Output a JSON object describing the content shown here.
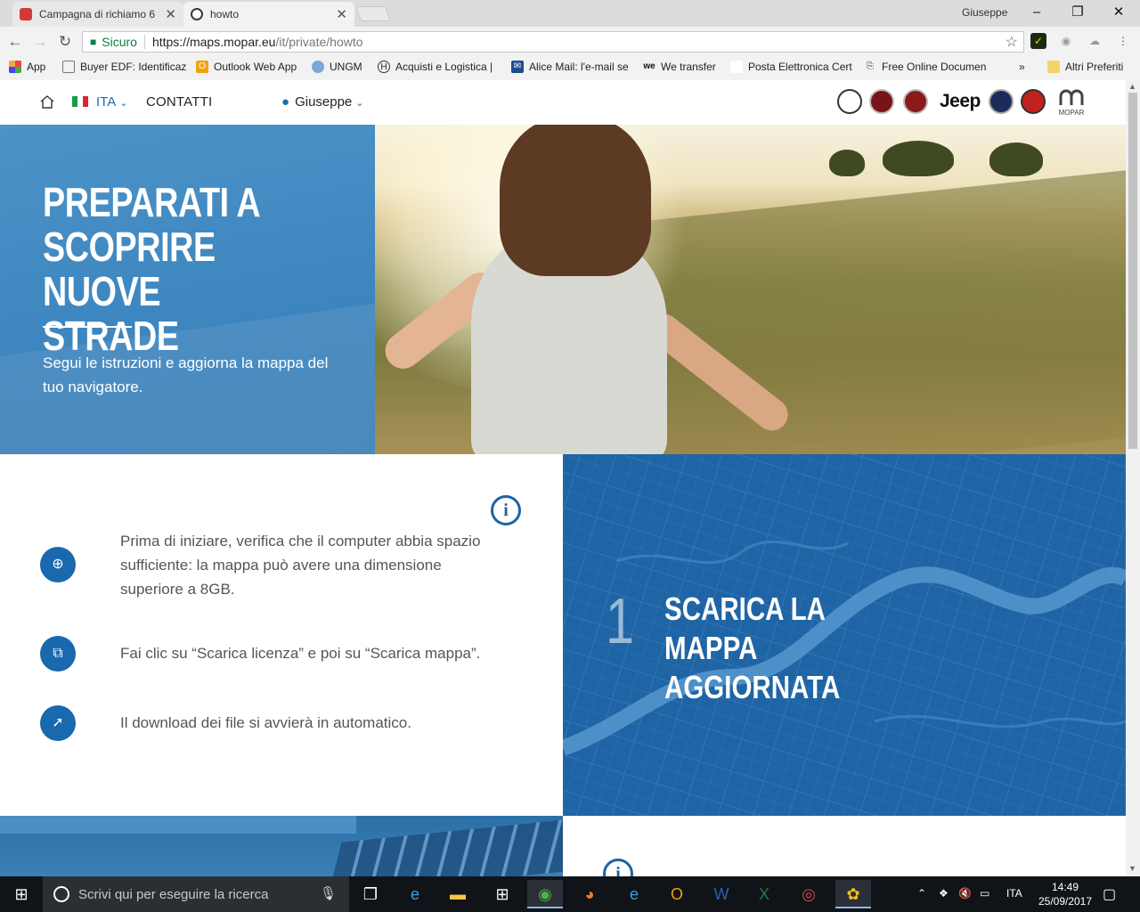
{
  "browser": {
    "tabs": [
      {
        "title": "Campagna di richiamo 6",
        "active": false,
        "favicon_color": "#d23a3a"
      },
      {
        "title": "howto",
        "active": true,
        "favicon_color": "#3a3a3a"
      }
    ],
    "window_user": "Giuseppe",
    "omnibox": {
      "secure_label": "Sicuro",
      "url_scheme_host": "https://maps.mopar.eu",
      "url_path": "/it/private/howto"
    },
    "bookmarks": [
      {
        "label": "App",
        "icon": "apps-grid-icon"
      },
      {
        "label": "Buyer EDF: Identificaz",
        "icon": "page-icon"
      },
      {
        "label": "Outlook Web App",
        "icon": "outlook-icon"
      },
      {
        "label": "UNGM",
        "icon": "un-icon"
      },
      {
        "label": "Acquisti e Logistica |",
        "icon": "h-logo-icon"
      },
      {
        "label": "Alice Mail: l'e-mail se",
        "icon": "mail-icon"
      },
      {
        "label": "We transfer",
        "icon": "wetransfer-icon"
      },
      {
        "label": "Posta Elettronica Cert",
        "icon": "page-icon"
      },
      {
        "label": "Free Online Documen",
        "icon": "docs-icon"
      },
      {
        "label": "Altri Preferiti",
        "icon": "folder-icon"
      }
    ]
  },
  "site_nav": {
    "language": "ITA",
    "contacts": "CONTATTI",
    "user": "Giuseppe",
    "brands": [
      "Alfa Romeo",
      "Fiat",
      "Fiat Professional",
      "Jeep",
      "Lancia",
      "Abarth",
      "Mopar"
    ],
    "jeep_label": "Jeep",
    "mopar_label": "MOPAR"
  },
  "hero": {
    "title": "PREPARATI A\nSCOPRIRE NUOVE\nSTRADE",
    "subtitle": "Segui le istruzioni e aggiorna la mappa del tuo navigatore."
  },
  "step1": {
    "number": "1",
    "title": "SCARICA LA\nMAPPA AGGIORNATA",
    "instructions": [
      {
        "icon": "magnifier-icon",
        "text": "Prima di iniziare, verifica che il computer abbia spazio sufficiente: la mappa può avere una dimensione superiore a 8GB."
      },
      {
        "icon": "download-click-icon",
        "text": "Fai clic su “Scarica licenza” e poi su “Scarica mappa”."
      },
      {
        "icon": "cursor-icon",
        "text": "Il download dei file si avvierà in automatico."
      }
    ]
  },
  "taskbar": {
    "search_placeholder": "Scrivi qui per eseguire la ricerca",
    "language": "ITA",
    "time": "14:49",
    "date": "25/09/2017"
  },
  "colors": {
    "brand_blue": "#1f64a5",
    "icon_blue": "#1a68ae",
    "hero_blue": "#3d86bf"
  }
}
